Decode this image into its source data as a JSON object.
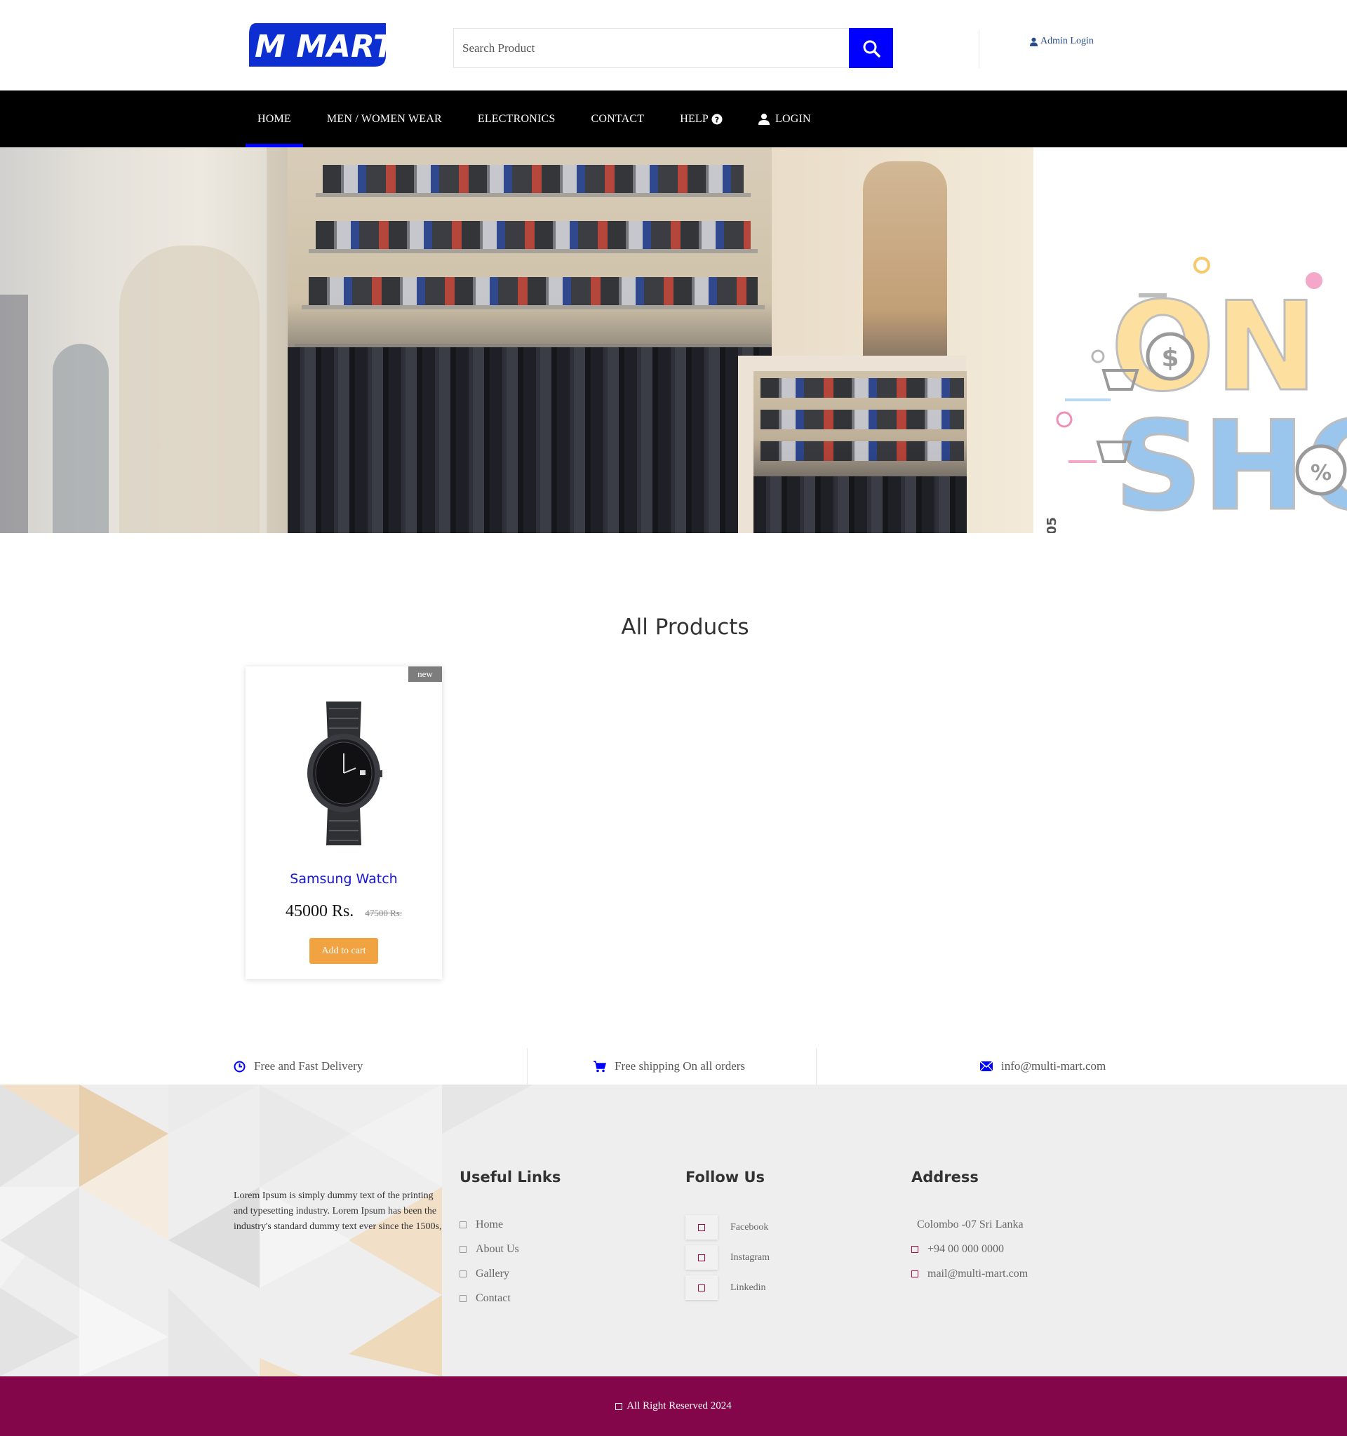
{
  "header": {
    "logo_text": "M MART",
    "search_placeholder": "Search Product",
    "admin_login": "Admin Login"
  },
  "nav": {
    "items": [
      {
        "label": "HOME",
        "active": true
      },
      {
        "label": "MEN / WOMEN WEAR",
        "active": false
      },
      {
        "label": "ELECTRONICS",
        "active": false
      },
      {
        "label": "CONTACT",
        "active": false
      },
      {
        "label": "HELP",
        "active": false,
        "icon": "question-circle-icon"
      },
      {
        "label": "LOGIN",
        "active": false,
        "icon": "user-icon"
      }
    ]
  },
  "hero": {
    "slide_count": 3,
    "active_slide": 3,
    "right_banner_text": [
      "ON",
      "SHO"
    ],
    "side_text": "05"
  },
  "products": {
    "title": "All Products",
    "items": [
      {
        "badge": "new",
        "name": "Samsung Watch",
        "price": "45000 Rs.",
        "old_price": "47500 Rs.",
        "button": "Add to cart",
        "image": "watch-image"
      }
    ]
  },
  "features": [
    {
      "icon": "clock-icon",
      "text": "Free and Fast Delivery"
    },
    {
      "icon": "cart-icon",
      "text": "Free shipping On all orders"
    },
    {
      "icon": "envelope-icon",
      "text": "info@multi-mart.com"
    }
  ],
  "footer": {
    "about": "Lorem Ipsum is simply dummy text of the printing and typesetting industry. Lorem Ipsum has been the industry's standard dummy text ever since the 1500s,",
    "useful_links": {
      "title": "Useful Links",
      "items": [
        "Home",
        "About Us",
        "Gallery",
        "Contact"
      ]
    },
    "follow_us": {
      "title": "Follow Us",
      "items": [
        "Facebook",
        "Instagram",
        "Linkedin"
      ]
    },
    "address": {
      "title": "Address",
      "line": "Colombo -07 Sri Lanka",
      "phone": "+94 00 000 0000",
      "email": "mail@multi-mart.com"
    },
    "copyright": "All Right Reserved 2024"
  },
  "colors": {
    "brand_blue": "#0000ff",
    "nav_bg": "#000000",
    "cart_button": "#f0a340",
    "footer_bar": "#84064a",
    "product_name": "#1515d6"
  }
}
